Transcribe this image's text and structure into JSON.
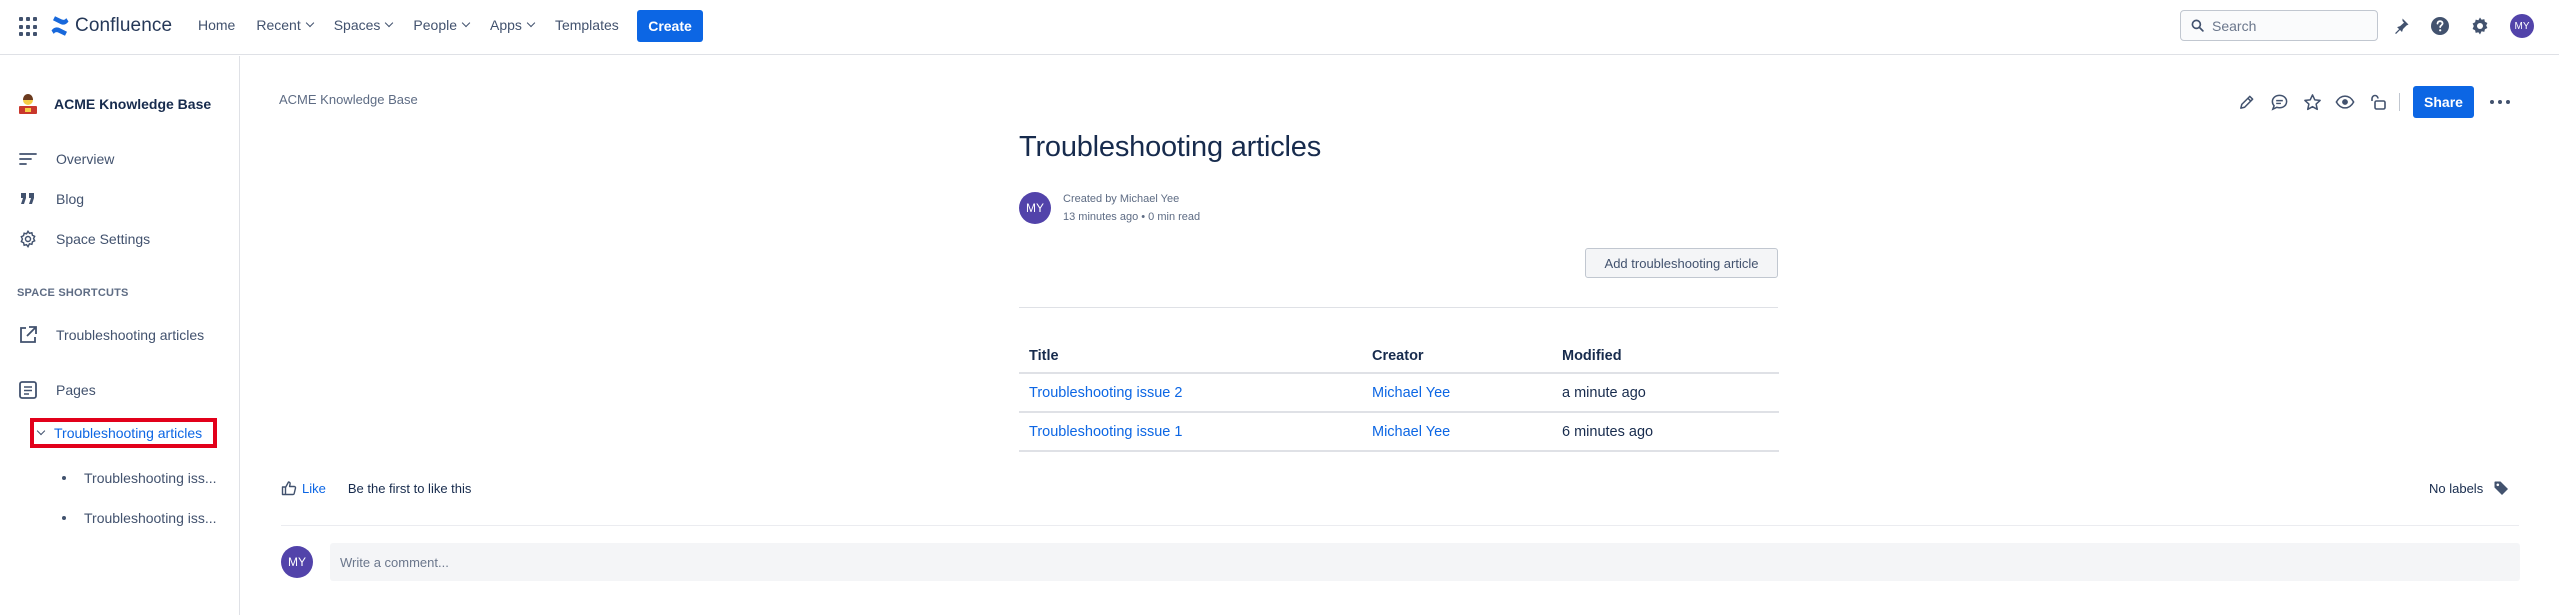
{
  "topnav": {
    "logo_text": "Confluence",
    "items": [
      {
        "label": "Home",
        "has_menu": false
      },
      {
        "label": "Recent",
        "has_menu": true
      },
      {
        "label": "Spaces",
        "has_menu": true
      },
      {
        "label": "People",
        "has_menu": true
      },
      {
        "label": "Apps",
        "has_menu": true
      },
      {
        "label": "Templates",
        "has_menu": false
      }
    ],
    "create_label": "Create",
    "search_placeholder": "Search",
    "avatar_initials": "MY",
    "icons": [
      "app-switcher-icon",
      "confluence-logo-icon",
      "search-icon",
      "notifications-icon",
      "help-icon",
      "settings-icon"
    ]
  },
  "sidebar": {
    "space_name": "ACME Knowledge Base",
    "links": [
      {
        "label": "Overview",
        "icon": "overview-icon"
      },
      {
        "label": "Blog",
        "icon": "blog-quote-icon"
      },
      {
        "label": "Space Settings",
        "icon": "gear-icon"
      }
    ],
    "shortcuts_title": "SPACE SHORTCUTS",
    "shortcuts": [
      {
        "label": "Troubleshooting articles",
        "icon": "external-link-icon"
      }
    ],
    "pages_label": "Pages",
    "tree": {
      "active": "Troubleshooting articles",
      "children": [
        "Troubleshooting iss...",
        "Troubleshooting iss..."
      ]
    }
  },
  "page": {
    "breadcrumb": "ACME Knowledge Base",
    "share_label": "Share",
    "title": "Troubleshooting articles",
    "author_initials": "MY",
    "created_by": "Created by Michael Yee",
    "meta": "13 minutes ago •  0 min read",
    "add_button": "Add troubleshooting article",
    "table": {
      "headers": [
        "Title",
        "Creator",
        "Modified"
      ],
      "rows": [
        {
          "title": "Troubleshooting issue 2",
          "creator": "Michael Yee",
          "modified": "a minute ago"
        },
        {
          "title": "Troubleshooting issue 1",
          "creator": "Michael Yee",
          "modified": "6 minutes ago"
        }
      ]
    },
    "like_label": "Like",
    "like_hint": "Be the first to like this",
    "labels_text": "No labels",
    "comment_avatar": "MY",
    "comment_placeholder": "Write a comment..."
  },
  "colors": {
    "accent": "#0c66e4",
    "avatar": "#5243aa",
    "highlight_border": "#e2001a"
  }
}
